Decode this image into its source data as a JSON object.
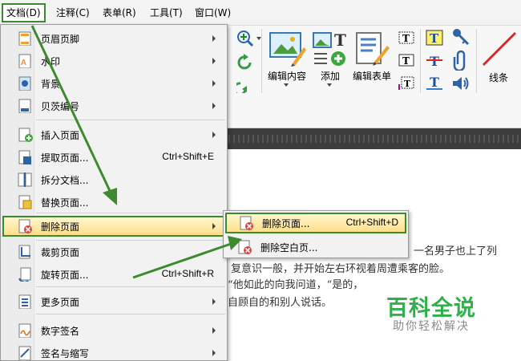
{
  "menubar": {
    "items": [
      {
        "label": "文档(D)"
      },
      {
        "label": "注释(C)"
      },
      {
        "label": "表单(R)"
      },
      {
        "label": "工具(T)"
      },
      {
        "label": "窗口(W)"
      }
    ]
  },
  "ribbon": {
    "edit_content": "编辑内容",
    "add": "添加",
    "edit_form": "编辑表单",
    "line": "线条"
  },
  "menu": {
    "items": [
      {
        "label": "页眉页脚",
        "shortcut": ""
      },
      {
        "label": "水印",
        "shortcut": ""
      },
      {
        "label": "背景",
        "shortcut": ""
      },
      {
        "label": "贝茨编号",
        "shortcut": ""
      },
      {
        "label": "插入页面",
        "shortcut": ""
      },
      {
        "label": "提取页面...",
        "shortcut": "Ctrl+Shift+E"
      },
      {
        "label": "拆分文档...",
        "shortcut": ""
      },
      {
        "label": "替换页面...",
        "shortcut": ""
      },
      {
        "label": "删除页面",
        "shortcut": ""
      },
      {
        "label": "裁剪页面",
        "shortcut": ""
      },
      {
        "label": "旋转页面...",
        "shortcut": "Ctrl+Shift+R"
      },
      {
        "label": "更多页面",
        "shortcut": ""
      },
      {
        "label": "数字签名",
        "shortcut": ""
      },
      {
        "label": "签名与缩写",
        "shortcut": ""
      }
    ]
  },
  "submenu": {
    "items": [
      {
        "label": "删除页面...",
        "shortcut": "Ctrl+Shift+D"
      },
      {
        "label": "删除空白页...",
        "shortcut": ""
      }
    ]
  },
  "doc": {
    "lines": [
      "一名男子也上了列",
      "复意识一般，并开始左右环视着周遭乘客的脸。",
      "“他如此的向我问道，“是的，",
      "自顾自的和别人说话。"
    ]
  },
  "watermark": {
    "main": "百科全说",
    "sub": "助你轻松解决"
  },
  "colors": {
    "highlight_border": "#3a8a2e",
    "arrow": "#3d8a2f",
    "watermark_green": "#2fb04a"
  }
}
